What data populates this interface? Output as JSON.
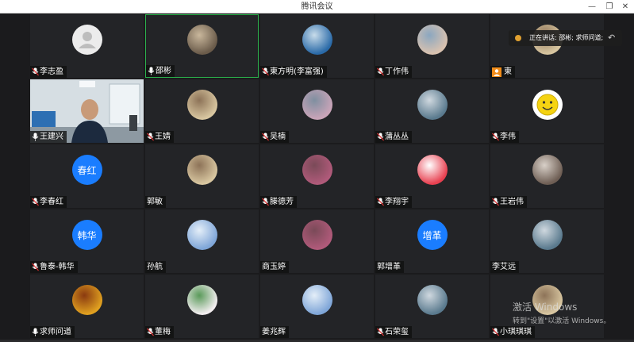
{
  "window": {
    "title": "腾讯会议"
  },
  "speaking_banner": {
    "text": "正在讲话: 邵彬; 求师问道;"
  },
  "watermark": {
    "line1": "激活 Windows",
    "line2": "转到\"设置\"以激活 Windows。"
  },
  "participants": [
    {
      "name": "李志盈",
      "mic": "muted",
      "avatar": "default-person"
    },
    {
      "name": "邵彬",
      "mic": "on",
      "avatar": "photo-group",
      "active": true
    },
    {
      "name": "東方明(李富强)",
      "mic": "muted",
      "avatar": "photo-calligraphy"
    },
    {
      "name": "丁作伟",
      "mic": "muted",
      "avatar": "photo-baby"
    },
    {
      "name": "東",
      "mic": "user-icon",
      "avatar": "photo-portrait"
    },
    {
      "name": "王建兴",
      "mic": "on",
      "avatar": "video"
    },
    {
      "name": "王婧",
      "mic": "muted",
      "avatar": "photo-portrait"
    },
    {
      "name": "吴楠",
      "mic": "muted",
      "avatar": "photo-blossom"
    },
    {
      "name": "蒲丛丛",
      "mic": "muted",
      "avatar": "photo-landscape"
    },
    {
      "name": "李伟",
      "mic": "muted",
      "avatar": "smiley"
    },
    {
      "name": "李春红",
      "mic": "muted",
      "avatar": "text",
      "avatar_text": "春红"
    },
    {
      "name": "郭敏",
      "mic": "none",
      "avatar": "photo-portrait"
    },
    {
      "name": "滕德芳",
      "mic": "muted",
      "avatar": "photo-flowers"
    },
    {
      "name": "李翔宇",
      "mic": "muted",
      "avatar": "photo-cartoon"
    },
    {
      "name": "王岩伟",
      "mic": "muted",
      "avatar": "photo-dog"
    },
    {
      "name": "鲁泰-韩华",
      "mic": "muted",
      "avatar": "text",
      "avatar_text": "韩华"
    },
    {
      "name": "孙航",
      "mic": "none",
      "avatar": "photo-sky"
    },
    {
      "name": "商玉婷",
      "mic": "none",
      "avatar": "photo-flowers"
    },
    {
      "name": "郭增革",
      "mic": "none",
      "avatar": "text",
      "avatar_text": "增革"
    },
    {
      "name": "李艾远",
      "mic": "none",
      "avatar": "photo-landscape"
    },
    {
      "name": "求师问道",
      "mic": "on",
      "avatar": "photo-autumn"
    },
    {
      "name": "董梅",
      "mic": "muted",
      "avatar": "photo-painting"
    },
    {
      "name": "姜兆辉",
      "mic": "none",
      "avatar": "photo-sky"
    },
    {
      "name": "石荣玺",
      "mic": "muted",
      "avatar": "photo-landscape"
    },
    {
      "name": "小琪琪琪",
      "mic": "muted",
      "avatar": "photo-portrait"
    }
  ],
  "colors": {
    "active_border": "#2bb24c",
    "text_avatar": "#1a7dff",
    "user_icon": "#f08c1a"
  }
}
